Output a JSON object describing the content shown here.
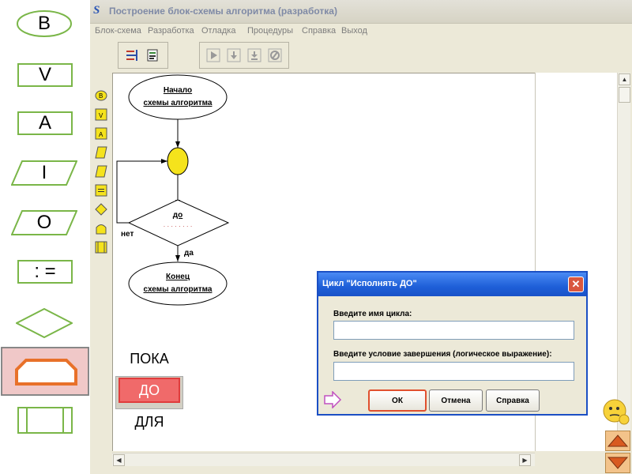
{
  "palette": {
    "items": [
      {
        "label": "B",
        "shape": "oval"
      },
      {
        "label": "V",
        "shape": "rect"
      },
      {
        "label": "A",
        "shape": "rect"
      },
      {
        "label": "I",
        "shape": "parallelogram"
      },
      {
        "label": "O",
        "shape": "parallelogram"
      },
      {
        "label": ": =",
        "shape": "rect"
      },
      {
        "label": "",
        "shape": "diamond"
      },
      {
        "label": "",
        "shape": "loop-hexagon",
        "selected": true
      },
      {
        "label": "",
        "shape": "subroutine"
      }
    ]
  },
  "window": {
    "app_icon": "S",
    "title": "Построение блок-схемы алгоритма (разработка)",
    "menu": [
      "Блок-схема",
      "Разработка",
      "Отладка",
      "Процедуры",
      "Справка",
      "Выход"
    ],
    "toolbar": {
      "group1": [
        "new-block-icon",
        "save-icon"
      ],
      "group2": [
        "run-icon",
        "step-into-icon",
        "step-over-icon",
        "stop-icon"
      ]
    },
    "vertical_toolbar": [
      "B",
      "V",
      "A",
      "I",
      "O",
      "=",
      "diamond",
      "loop",
      "sub"
    ]
  },
  "flowchart": {
    "start_line1": "Начало",
    "start_line2": "схемы алгоритма",
    "cond_label": "до",
    "cond_dots": "· · · · · · · ·",
    "no_label": "нет",
    "yes_label": "да",
    "end_line1": "Конец",
    "end_line2": "схемы алгоритма"
  },
  "loop_types": {
    "while": "ПОКА",
    "until": "ДО",
    "for": "ДЛЯ"
  },
  "dialog": {
    "title": "Цикл \"Исполнять ДО\"",
    "label_name": "Введите имя цикла:",
    "name_value": "",
    "label_condition": "Введите условие завершения (логическое выражение):",
    "condition_value": "",
    "ok": "ОК",
    "cancel": "Отмена",
    "help": "Справка"
  },
  "nav": {
    "up_icon": "triangle-up-icon",
    "down_icon": "triangle-down-icon",
    "emoji_icon": "thinking-smiley-icon"
  },
  "colors": {
    "palette_selected_bg": "#f0c8c8",
    "shape_orange": "#e8712a",
    "dialog_title": "#1e5fd8",
    "ok_border": "#e0502e",
    "junction": "#f5e31c",
    "do_bg": "#f06a6a"
  }
}
